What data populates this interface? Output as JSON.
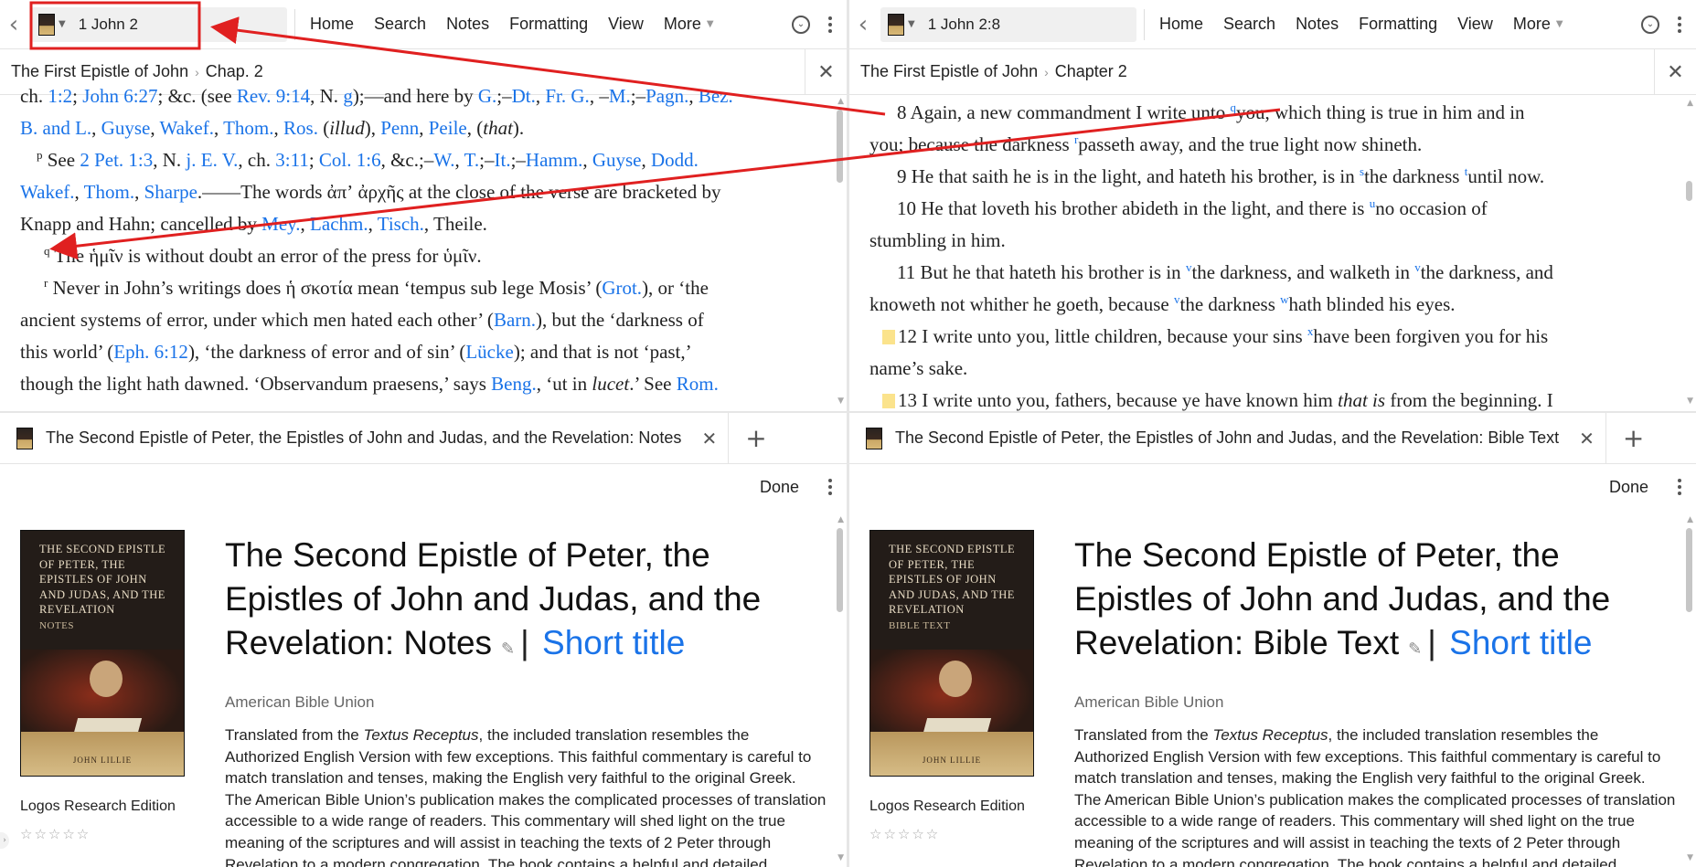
{
  "panes": {
    "top_left": {
      "reference": "1 John 2",
      "menu": [
        "Home",
        "Search",
        "Notes",
        "Formatting",
        "View",
        "More"
      ],
      "breadcrumb": [
        "The First Epistle of John",
        "Chap. 2"
      ]
    },
    "top_right": {
      "reference": "1 John 2:8",
      "menu": [
        "Home",
        "Search",
        "Notes",
        "Formatting",
        "View",
        "More"
      ],
      "breadcrumb": [
        "The First Epistle of John",
        "Chapter 2"
      ]
    },
    "bottom_left": {
      "tab_title": "The Second Epistle of Peter, the Epistles of John and Judas, and the Revelation: Notes",
      "done": "Done",
      "cover_title": "The Second Epistle of Peter, the Epistles of John and Judas, and the Revelation",
      "cover_subtitle": "Notes",
      "cover_author": "JOHN LILLIE",
      "title": "The Second Epistle of Peter, the Epistles of John and Judas, and the Revelation: Notes",
      "short_title": "Short title",
      "author": "American Bible Union",
      "edition": "Logos Research Edition"
    },
    "bottom_right": {
      "tab_title": "The Second Epistle of Peter, the Epistles of John and Judas, and the Revelation: Bible Text",
      "done": "Done",
      "cover_title": "The Second Epistle of Peter, the Epistles of John and Judas, and the Revelation",
      "cover_subtitle": "Bible Text",
      "cover_author": "JOHN LILLIE",
      "title": "The Second Epistle of Peter, the Epistles of John and Judas, and the Revelation: Bible Text",
      "short_title": "Short title",
      "author": "American Bible Union",
      "edition": "Logos Research Edition"
    }
  },
  "description": {
    "a": "Translated from the ",
    "em": "Textus Receptus",
    "b": ", the included translation resembles the Authorized English Version with few exceptions. This faithful commentary is careful to match translation and tenses, making the English very faithful to the original Greek. The American Bible Union’s publication makes the complicated processes of translation accessible to a wide range of readers. This commentary will shed light on the true meaning of the scriptures and will assist in teaching the texts of 2 Peter through Revelation to a modern congregation. The book contains a helpful and detailed commentary followed"
  },
  "notes_text": {
    "l0_a": "ch. ",
    "l0_r1": "1:2",
    "l0_b": "; ",
    "l0_r2": "John 6:27",
    "l0_c": "; &c. (see ",
    "l0_r3": "Rev. 9:14",
    "l0_d": ", N. ",
    "l0_r4": "g",
    "l0_e": ");—and here by ",
    "l0_r5": "G.",
    "l0_f": ";–",
    "l0_r6": "Dt.",
    "l0_g": ", ",
    "l0_r7": "Fr. G.",
    "l0_h": ", –",
    "l0_r8": "M.",
    "l0_i": ";–",
    "l0_r9": "Pagn.",
    "l0_j": ", ",
    "l0_r10": "Bez.",
    "l1_r1": "B. and L.",
    "l1_r2": "Guyse",
    "l1_r3": "Wakef.",
    "l1_r4": "Thom.",
    "l1_r5": "Ros.",
    "l1_a": "illud",
    "l1_r6": "Penn",
    "l1_r7": "Peile",
    "l1_b": "that",
    "p_mark": "p",
    "p_a": " See ",
    "p_r1": "2 Pet. 1:3",
    "p_b": ", N. ",
    "p_r2": "j. E. V.",
    "p_c": ", ch. ",
    "p_r3": "3:11",
    "p_d": "; ",
    "p_r4": "Col. 1:6",
    "p_e": ", &c.;–",
    "p_r5": "W.",
    "p_f": ", ",
    "p_r6": "T.",
    "p_g": ";–",
    "p_r7": "It.",
    "p_h": ";–",
    "p_r8": "Hamm.",
    "p_r9": "Guyse",
    "p_r10": "Dodd.",
    "w_r1": "Wakef.",
    "w_r2": "Thom.",
    "w_r3": "Sharpe",
    "w_a": ".——The words ἀπʼ ἀρχῆς at the close of the verse are bracketed by",
    "k_a": "Knapp and Hahn; cancelled by ",
    "k_r1": "Mey.",
    "k_r2": "Lachm.",
    "k_r3": "Tisch.",
    "k_b": ", Theile.",
    "q_mark": "q",
    "q_a": " The ἡμῖν is without doubt an error of the press for ὑμῖν.",
    "r_mark": "r",
    "r_a": " Never in John’s writings does ἡ σκοτία mean ‘tempus sub lege Mosis’ (",
    "r_r1": "Grot.",
    "r_b": "), or ‘the",
    "s_a": "ancient systems of error, under which men hated each other’ (",
    "s_r1": "Barn.",
    "s_b": "), but the ‘darkness of",
    "t_a": "this world’ (",
    "t_r1": "Eph. 6:12",
    "t_b": "), ‘the darkness of error and of sin’ (",
    "t_r2": "Lücke",
    "t_c": "); and that is not ‘past,’",
    "u_a": "though the light hath dawned. ‘Observandum praesens,’ says ",
    "u_r1": "Beng.",
    "u_b": ", ‘ut in ",
    "u_em": "lucet",
    "u_c": ".’ See ",
    "u_r2": "Rom."
  },
  "bible_text": {
    "v8_a": "8 Again, a new commandment I write unto ",
    "v8_s1": "q",
    "v8_b": "you, which thing is true in him and in",
    "v8_c": "you; because the darkness ",
    "v8_s2": "r",
    "v8_d": "passeth away, and the true light now shineth.",
    "v9_a": "9 He that saith he is in the light, and hateth his brother, is in ",
    "v9_s1": "s",
    "v9_b": "the darkness ",
    "v9_s2": "t",
    "v9_c": "until now.",
    "v10_a": "10 He that loveth his brother abideth in the light, and there is ",
    "v10_s1": "u",
    "v10_b": "no occasion of",
    "v10_c": "stumbling in him.",
    "v11_a": "11 But he that hateth his brother is in ",
    "v11_s1": "v",
    "v11_b": "the darkness, and walketh in ",
    "v11_s2": "v",
    "v11_c": "the darkness, and",
    "v11_d": "knoweth not whither he goeth, because ",
    "v11_s3": "v",
    "v11_e": "the darkness ",
    "v11_s4": "w",
    "v11_f": "hath blinded his eyes.",
    "v12_a": "12 I write unto you, little children, because your sins ",
    "v12_s1": "x",
    "v12_b": "have been forgiven you for his",
    "v12_c": "name’s sake.",
    "v13_a": "13 I write unto you, fathers, because ye have known him ",
    "v13_em": "that is",
    "v13_b": " from the beginning. I"
  },
  "colors": {
    "link": "#1a73e8",
    "annotation": "#e02020",
    "highlight": "#fbe38c"
  }
}
